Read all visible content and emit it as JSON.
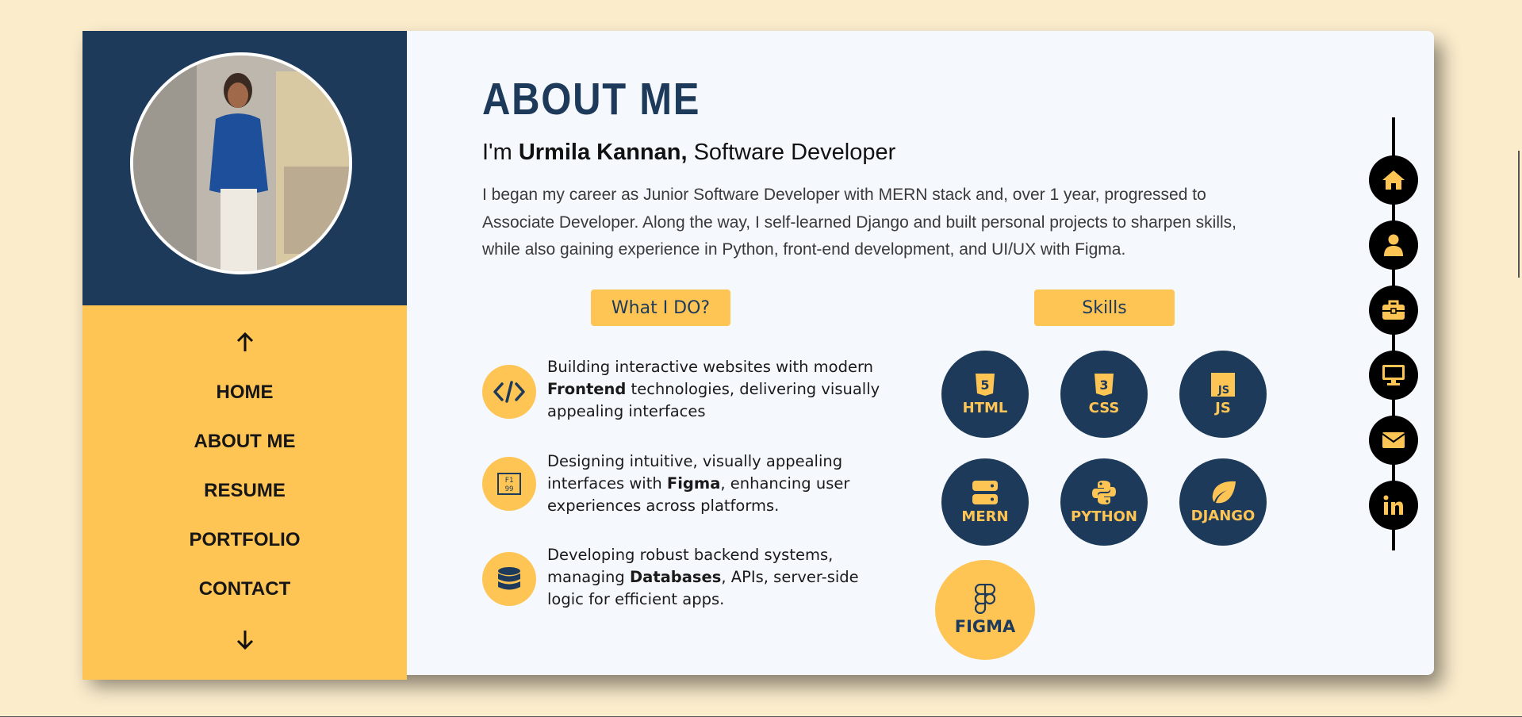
{
  "nav": {
    "items": [
      {
        "label": "HOME"
      },
      {
        "label": "ABOUT ME"
      },
      {
        "label": "RESUME"
      },
      {
        "label": "PORTFOLIO"
      },
      {
        "label": "CONTACT"
      }
    ],
    "up_icon": "arrow-up-icon",
    "down_icon": "arrow-down-icon"
  },
  "about": {
    "title": "ABOUT ME",
    "intro_prefix": "I'm ",
    "name": "Urmila Kannan,",
    "role": " Software Developer",
    "bio": "I began my career as Junior Software Developer with MERN stack and, over 1 year, progressed to Associate Developer. Along the way, I self-learned Django and built personal projects to sharpen skills, while also gaining experience in Python, front-end development, and UI/UX with Figma."
  },
  "what_i_do": {
    "heading": "What I DO?",
    "items": [
      {
        "icon": "code-icon",
        "pre": "Building interactive websites with modern ",
        "bold": "Frontend",
        "post": " technologies, delivering visually appealing interfaces"
      },
      {
        "icon": "figma-board-icon",
        "pre": "Designing intuitive, visually appealing interfaces with ",
        "bold": "Figma",
        "post": ", enhancing user experiences across platforms."
      },
      {
        "icon": "database-icon",
        "pre": "Developing robust backend systems, managing ",
        "bold": "Databases",
        "post": ", APIs, server-side logic for efficient apps."
      }
    ]
  },
  "skills": {
    "heading": "Skills",
    "items": [
      {
        "label": "HTML",
        "icon": "html5-icon"
      },
      {
        "label": "CSS",
        "icon": "css3-icon"
      },
      {
        "label": "JS",
        "icon": "js-icon"
      },
      {
        "label": "MERN",
        "icon": "server-icon"
      },
      {
        "label": "PYTHON",
        "icon": "python-icon"
      },
      {
        "label": "DJANGO",
        "icon": "leaf-icon"
      },
      {
        "label": "FIGMA",
        "icon": "figma-icon"
      }
    ]
  },
  "side_nav": [
    "home-icon",
    "user-icon",
    "briefcase-icon",
    "desktop-icon",
    "envelope-icon",
    "linkedin-icon"
  ],
  "colors": {
    "page_bg": "#fbeccc",
    "navy": "#1e3a5a",
    "yellow": "#fec555",
    "card_bg": "#f5f8fd"
  }
}
